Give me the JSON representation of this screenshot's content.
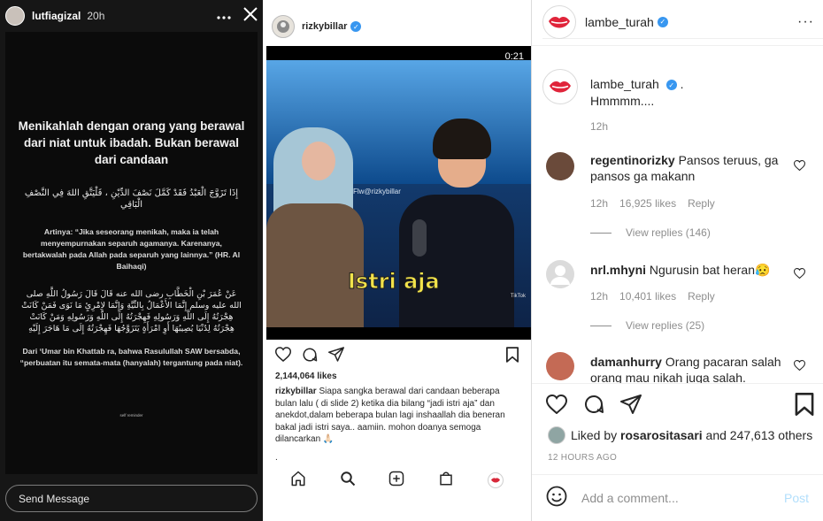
{
  "story": {
    "username": "lutfiagizal",
    "time": "20h",
    "heading": "Menikahlah dengan orang yang berawal dari niat untuk ibadah. Bukan berawal dari candaan",
    "arabic_1": "إِذَا تَزَوَّجَ الْعَبْدُ فَقَدْ كَمَّلَ نَصْفَ الدِّيْنِ ، فَلْيَتَّقِ اللهَ فِي النَّصْفِ الْبَاقِي",
    "translation": "Artinya: “Jika seseorang menikah, maka ia telah menyempurnakan separuh agamanya. Karenanya, bertakwalah pada Allah pada separuh yang lainnya.” (HR. Al Baihaqi)",
    "arabic_2": "عَنْ عُمَرَ بْنِ الْخَطَّابِ رضى الله عنه قَالَ قَالَ رَسُولُ اللَّهِ صلى الله عليه وسلم إِنَّمَا الأَعْمَالُ بِالنِّيَّةِ وَإِنَّمَا لاِمْرِئٍ مَا نَوَى فَمَنْ كَانَتْ هِجْرَتُهُ إِلَى اللَّهِ وَرَسُولِهِ فَهِجْرَتُهُ إِلَى اللَّهِ وَرَسُولِهِ وَمَنْ كَانَتْ هِجْرَتُهُ لِدُنْيَا يُصِيبُهَا أَوِ امْرَأَةٍ يَتَزَوَّجُهَا فَهِجْرَتُهُ إِلَى مَا هَاجَرَ إِلَيْهِ",
    "hadith": "Dari ‘Umar bin Khattab ra, bahwa Rasulullah SAW bersabda, “perbuatan itu semata-mata (hanyalah) tergantung pada niat).",
    "tiny": "self reminder",
    "message_placeholder": "Send Message"
  },
  "phone": {
    "username": "rizkybillar",
    "video_time": "0:21",
    "video_watermark": "Flw@rizkybillar",
    "video_caption": "Istri aja",
    "tiktok_mark": "TikTok",
    "likes": "2,144,064 likes",
    "caption_user": "rizkybillar",
    "caption_text": "Siapa sangka berawal dari candaan beberapa bulan lalu ( di slide 2) ketika dia bilang “jadi istri aja” dan anekdot,dalam beberapa bulan lagi inshaallah dia beneran bakal jadi istri saya.. aamiin. mohon doanya semoga dilancarkan 🙏🏻",
    "dot": "."
  },
  "post": {
    "username": "lambe_turah",
    "caption_user": "lambe_turah",
    "caption_suffix": ".",
    "caption_text": "Hmmmm....",
    "caption_time": "12h",
    "comments": [
      {
        "user": "regentinorizky",
        "text": "Pansos teruus, ga pansos ga makann",
        "time": "12h",
        "likes": "16,925 likes",
        "reply": "Reply",
        "view_replies": "View replies (146)",
        "avatar_color": "#6a4a3a"
      },
      {
        "user": "nrl.mhyni",
        "text": "Ngurusin bat heran😥",
        "time": "12h",
        "likes": "10,401 likes",
        "reply": "Reply",
        "view_replies": "View replies (25)",
        "avatar_color": "#dbdbdb"
      },
      {
        "user": "damanhurry",
        "text": "Orang pacaran salah orang mau nikah juga salah.",
        "avatar_color": "#c46a55"
      }
    ],
    "liked_by_prefix": "Liked by",
    "liked_by_user": "rosarositasari",
    "liked_by_suffix": "and 247,613 others",
    "time_ago": "12 HOURS AGO",
    "add_comment_placeholder": "Add a comment...",
    "post_button": "Post"
  }
}
